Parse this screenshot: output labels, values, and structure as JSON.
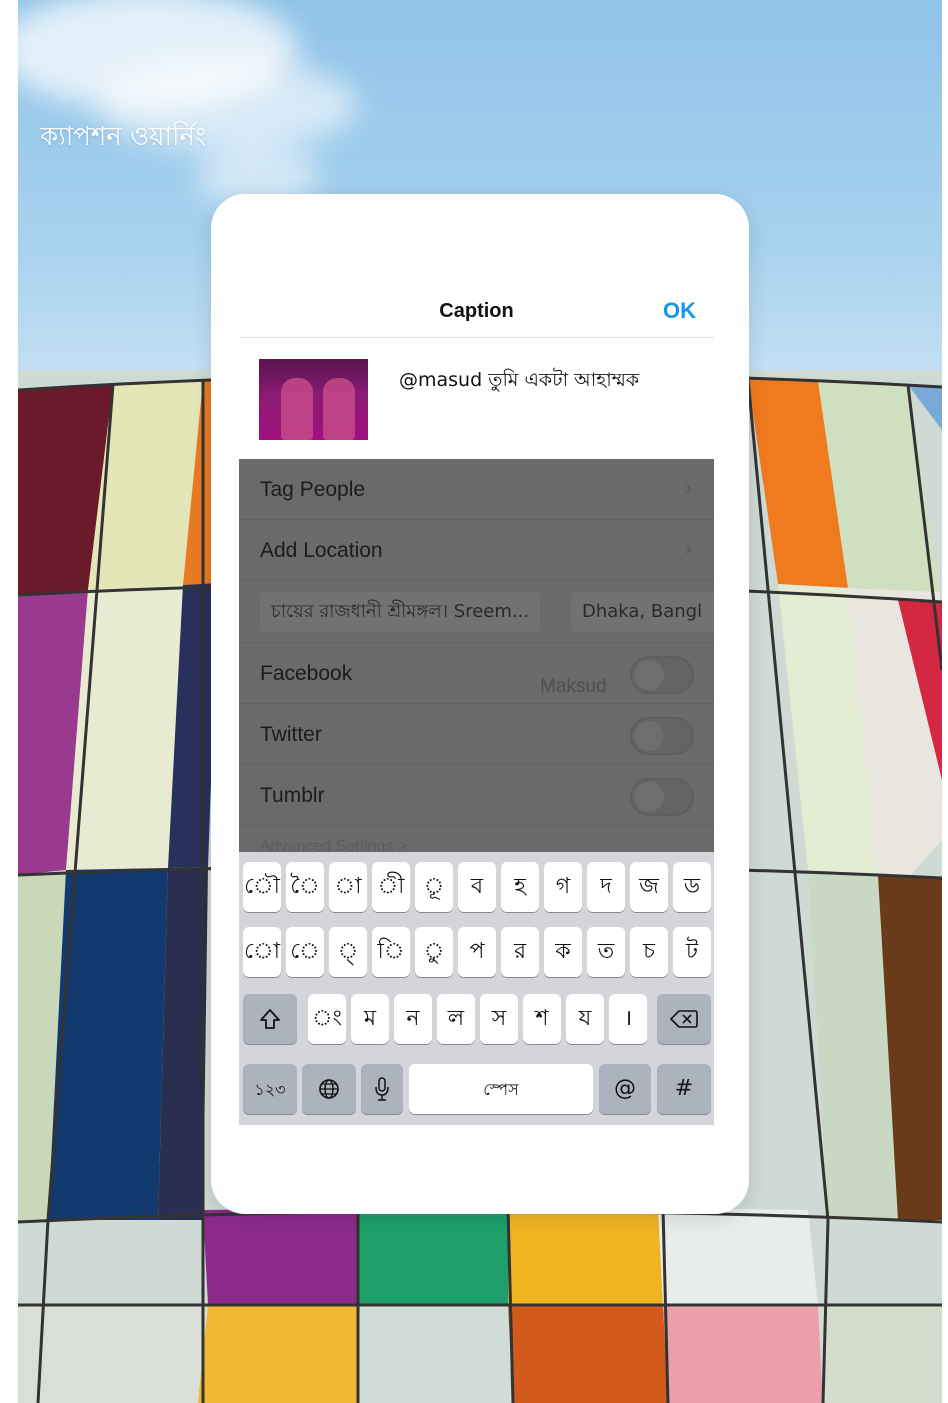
{
  "title": "ক্যাপশন ওয়ার্নিং",
  "dialog": {
    "nav_title": "Caption",
    "ok_label": "OK",
    "caption_text": "@masud তুমি একটা আহাম্মক",
    "rows": {
      "tag_people": "Tag People",
      "add_location": "Add Location",
      "chip_1": "চায়ের রাজধানী শ্রীমঙ্গল। Sreem...",
      "chip_2": "Dhaka, Bangl",
      "facebook": "Facebook",
      "twitter": "Twitter",
      "tumblr": "Tumblr",
      "advanced": "Advanced Settings >",
      "mention_suggestion": "Maksud"
    }
  },
  "keyboard": {
    "row1": [
      "ৌ",
      "ৈ",
      "া",
      "ী",
      "ূ",
      "ব",
      "হ",
      "গ",
      "দ",
      "জ",
      "ড"
    ],
    "row2": [
      "ো",
      "ে",
      "্",
      "ি",
      "ু",
      "প",
      "র",
      "ক",
      "ত",
      "চ",
      "ট"
    ],
    "row3": [
      "ং",
      "ম",
      "ন",
      "ল",
      "স",
      "শ",
      "য",
      "।"
    ],
    "num_key": "১২৩",
    "space": "স্পেস",
    "at": "@",
    "hash": "#",
    "shift_icon": "shift-icon",
    "delete_icon": "delete-icon",
    "globe_icon": "globe-icon",
    "mic_icon": "mic-icon"
  },
  "colors": {
    "accent": "#1596ef",
    "overlay": "#6a6a6a"
  }
}
